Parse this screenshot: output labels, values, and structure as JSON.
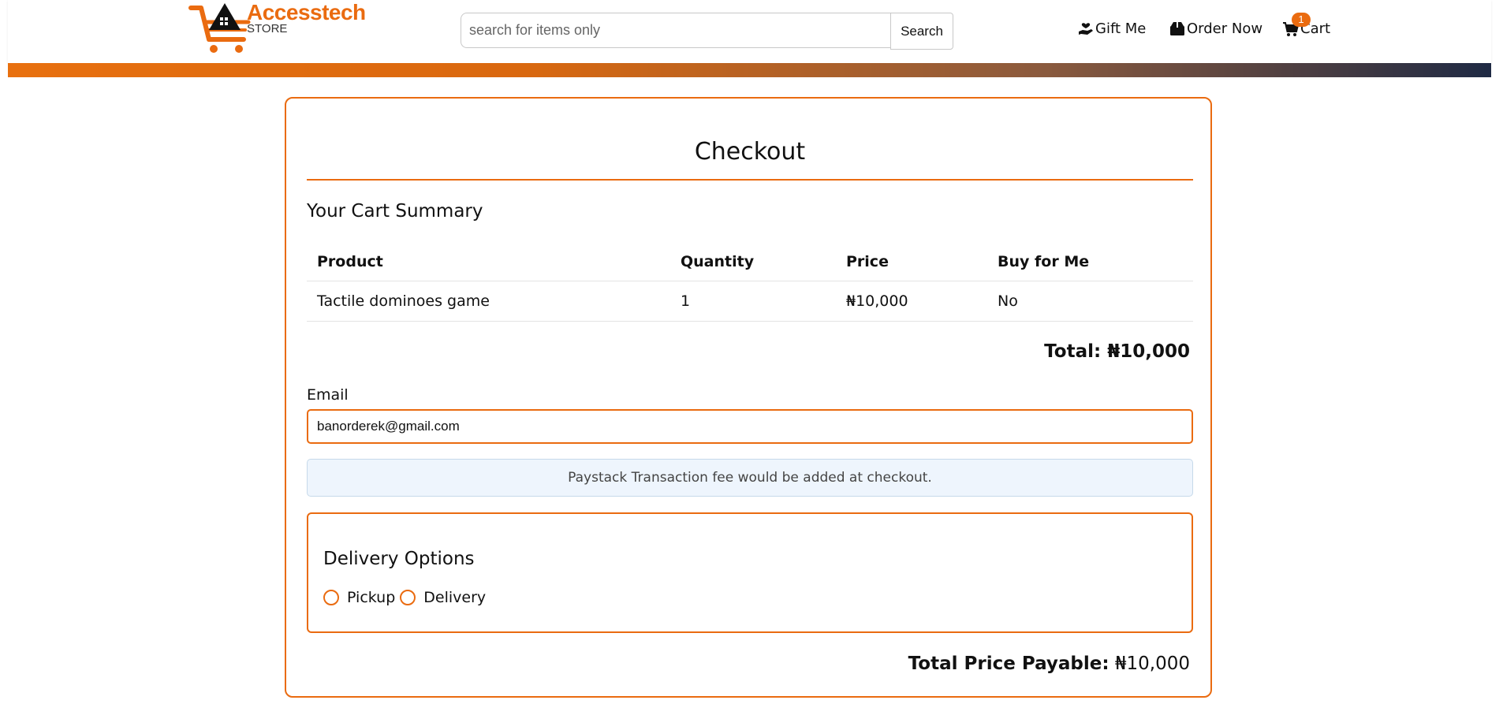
{
  "header": {
    "logo_text": "Accesstech",
    "logo_sub": "STORE",
    "search": {
      "placeholder": "search for items only",
      "button_label": "Search"
    },
    "links": {
      "gift": "Gift Me",
      "order": "Order Now",
      "cart": "Cart"
    },
    "cart_count": "1"
  },
  "colors": {
    "accent": "#ea6b10",
    "info_bg": "#eef5fd"
  },
  "checkout": {
    "title": "Checkout",
    "summary_heading": "Your Cart Summary",
    "columns": [
      "Product",
      "Quantity",
      "Price",
      "Buy for Me"
    ],
    "rows": [
      {
        "product": "Tactile dominoes game",
        "quantity": "1",
        "price": "₦10,000",
        "buy_for_me": "No"
      }
    ],
    "total_label": "Total:",
    "total_value": "₦10,000",
    "email_label": "Email",
    "email_value": "banorderek@gmail.com",
    "fee_note": "Paystack Transaction fee would be added at checkout.",
    "delivery": {
      "heading": "Delivery Options",
      "options": [
        "Pickup",
        "Delivery"
      ]
    },
    "payable_label": "Total Price Payable:",
    "payable_value": "₦10,000"
  }
}
